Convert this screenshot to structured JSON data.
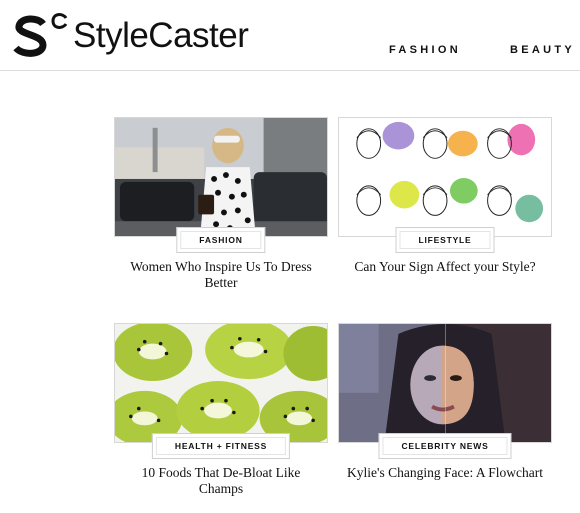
{
  "brand": {
    "name": "StyleCaster"
  },
  "nav": [
    "FASHION",
    "BEAUTY"
  ],
  "articles": [
    {
      "tag": "FASHION",
      "title": "Women Who Inspire Us To Dress Better"
    },
    {
      "tag": "LIFESTYLE",
      "title": "Can Your Sign Affect your Style?"
    },
    {
      "tag": "HEALTH + FITNESS",
      "title": "10 Foods That De-Bloat Like Champs"
    },
    {
      "tag": "CELEBRITY NEWS",
      "title": "Kylie's Changing Face: A Flowchart"
    }
  ]
}
